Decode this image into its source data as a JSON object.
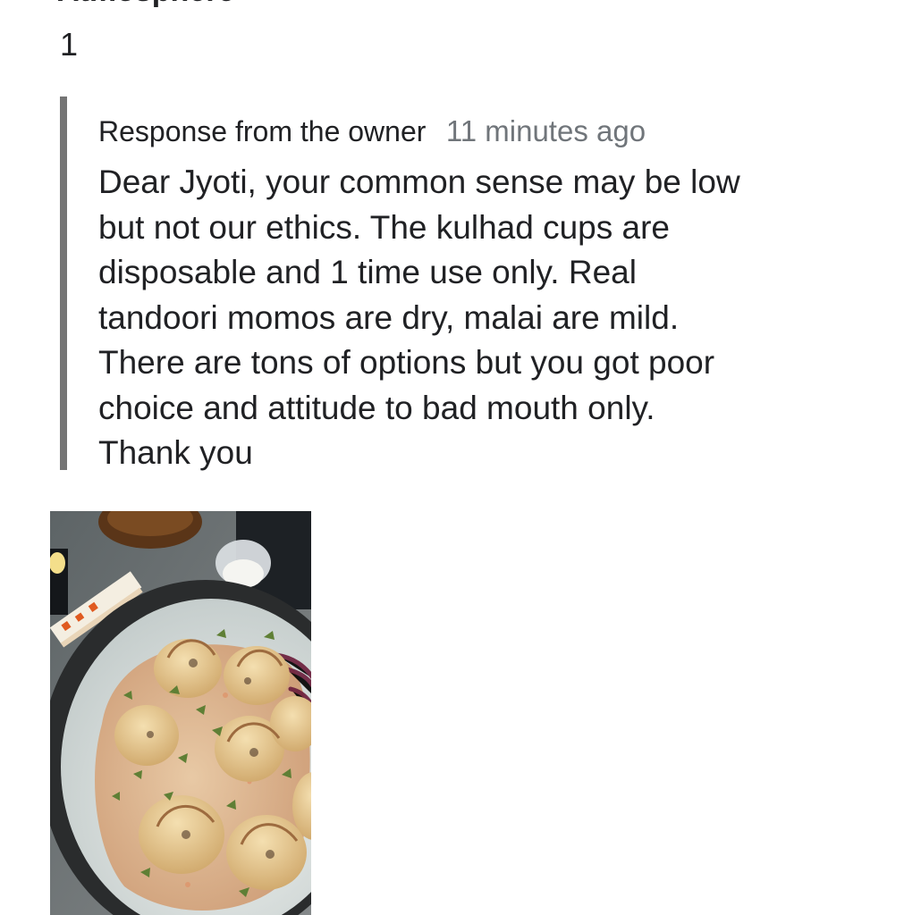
{
  "review": {
    "section_heading": "Atmosphere",
    "atmosphere_rating": "1",
    "owner_response": {
      "title": "Response from the owner",
      "time": "11 minutes ago",
      "lines": [
        "Dear Jyoti, your common sense may be low",
        "but not our ethics. The kulhad cups are",
        "disposable and 1 time use only. Real",
        "tandoori momos are dry, malai are mild.",
        "There are tons of options but you got poor",
        "choice and attitude to bad mouth only.",
        "Thank you"
      ]
    },
    "photo": {
      "subject": "malai momos"
    }
  },
  "colors": {
    "text_primary": "#202124",
    "text_secondary": "#70757a",
    "quote_bar": "#757575",
    "background": "#ffffff"
  }
}
